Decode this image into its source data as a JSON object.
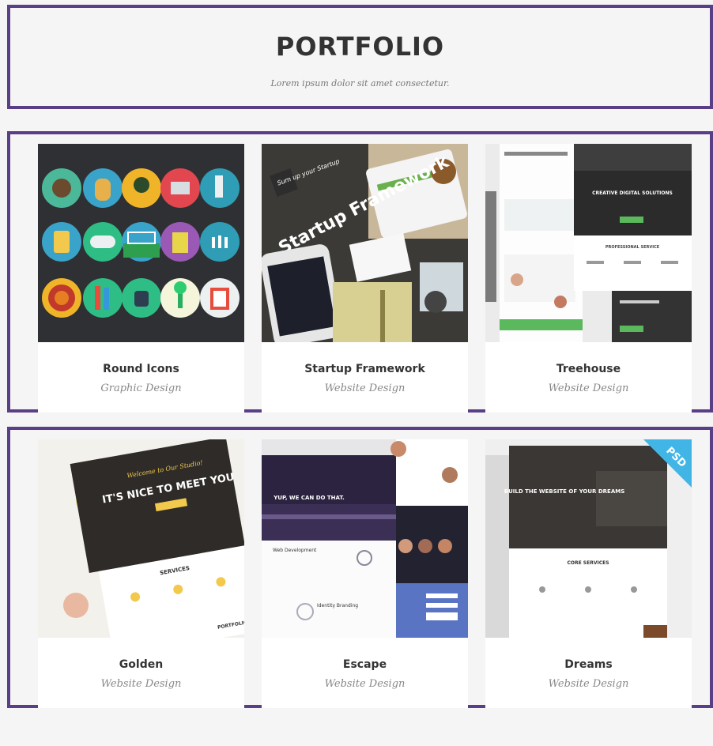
{
  "header": {
    "title": "PORTFOLIO",
    "subtitle": "Lorem ipsum dolor sit amet consectetur."
  },
  "items": [
    {
      "title": "Round Icons",
      "category": "Graphic Design"
    },
    {
      "title": "Startup Framework",
      "category": "Website Design",
      "image_text": {
        "sticker": "Sum up your Startup",
        "headline": "Startup Framework"
      }
    },
    {
      "title": "Treehouse",
      "category": "Website Design",
      "image_text": {
        "hero": "CREATIVE DIGITAL SOLUTIONS",
        "services": "PROFESSIONAL SERVICE"
      }
    },
    {
      "title": "Golden",
      "category": "Website Design",
      "image_text": {
        "greeting": "Welcome to Our Studio!",
        "headline": "IT'S NICE TO MEET YOU",
        "services": "SERVICES",
        "portfolio": "PORTFOLIO"
      }
    },
    {
      "title": "Escape",
      "category": "Website Design",
      "image_text": {
        "headline": "YUP, WE CAN DO THAT.",
        "web": "Web Development",
        "branding": "Identity Branding"
      }
    },
    {
      "title": "Dreams",
      "category": "Website Design",
      "image_text": {
        "headline": "BUILD THE WEBSITE OF YOUR DREAMS",
        "services": "CORE SERVICES",
        "badge": "PSD"
      }
    }
  ],
  "colors": {
    "frame": "#5b3f86",
    "background": "#f5f5f5",
    "card": "#ffffff"
  }
}
